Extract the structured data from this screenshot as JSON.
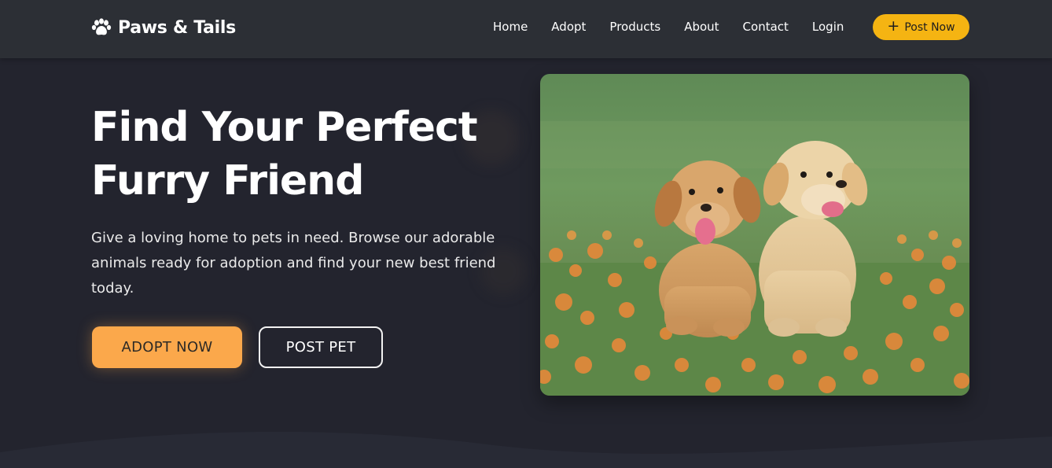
{
  "brand": {
    "name": "Paws & Tails",
    "icon": "paw-icon"
  },
  "nav": {
    "links": [
      "Home",
      "Adopt",
      "Products",
      "About",
      "Contact",
      "Login"
    ],
    "cta_label": "Post Now",
    "cta_icon": "plus-icon"
  },
  "hero": {
    "title_line1": "Find Your Perfect",
    "title_line2": "Furry Friend",
    "description": "Give a loving home to pets in need. Browse our adorable animals ready for adoption and find your new best friend today.",
    "primary_button": "ADOPT NOW",
    "secondary_button": "POST PET",
    "image_subject": "two golden retriever puppies sitting in grass with orange flowers"
  },
  "colors": {
    "background": "#23242e",
    "navbar": "#2c2f35",
    "accent_yellow": "#f5b412",
    "accent_orange": "#fba84b"
  }
}
